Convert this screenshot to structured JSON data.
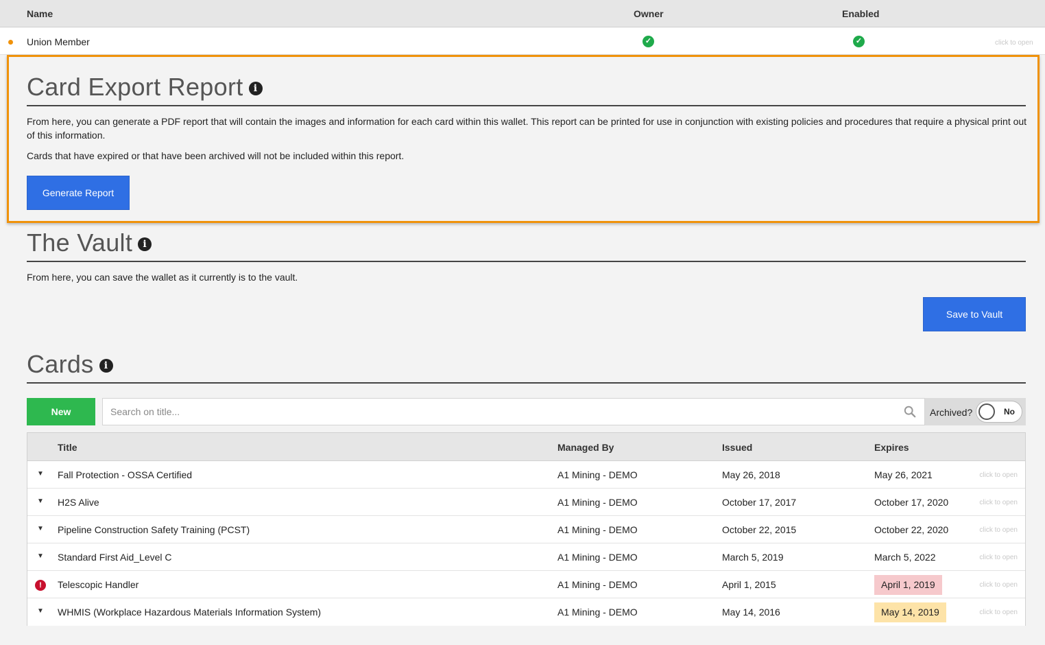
{
  "roles": {
    "headers": {
      "name": "Name",
      "owner": "Owner",
      "enabled": "Enabled"
    },
    "row": {
      "name": "Union Member",
      "hint": "click to open"
    }
  },
  "export": {
    "title": "Card Export Report",
    "para1": "From here, you can generate a PDF report that will contain the images and information for each card within this wallet. This report can be printed for use in conjunction with existing policies and procedures that require a physical print out of this information.",
    "para2": "Cards that have expired or that have been archived will not be included within this report.",
    "button": "Generate Report"
  },
  "vault": {
    "title": "The Vault",
    "para": "From here, you can save the wallet as it currently is to the vault.",
    "button": "Save to Vault"
  },
  "cards": {
    "title": "Cards",
    "new_button": "New",
    "search_placeholder": "Search on title...",
    "archived_label": "Archived?",
    "archived_value": "No",
    "headers": {
      "title": "Title",
      "managed_by": "Managed By",
      "issued": "Issued",
      "expires": "Expires"
    },
    "hint": "click to open",
    "rows": [
      {
        "title": "Fall Protection - OSSA Certified",
        "managed_by": "A1 Mining - DEMO",
        "issued": "May 26, 2018",
        "expires": "May 26, 2021",
        "status": "ok"
      },
      {
        "title": "H2S Alive",
        "managed_by": "A1 Mining - DEMO",
        "issued": "October 17, 2017",
        "expires": "October 17, 2020",
        "status": "ok"
      },
      {
        "title": "Pipeline Construction Safety Training (PCST)",
        "managed_by": "A1 Mining - DEMO",
        "issued": "October 22, 2015",
        "expires": "October 22, 2020",
        "status": "ok"
      },
      {
        "title": "Standard First Aid_Level C",
        "managed_by": "A1 Mining - DEMO",
        "issued": "March 5, 2019",
        "expires": "March 5, 2022",
        "status": "ok"
      },
      {
        "title": "Telescopic Handler",
        "managed_by": "A1 Mining - DEMO",
        "issued": "April 1, 2015",
        "expires": "April 1, 2019",
        "status": "expired"
      },
      {
        "title": "WHMIS (Workplace Hazardous Materials Information System)",
        "managed_by": "A1 Mining - DEMO",
        "issued": "May 14, 2016",
        "expires": "May 14, 2019",
        "status": "expiring"
      }
    ]
  },
  "colors": {
    "accent_blue": "#2f6fe4",
    "new_green": "#2eb84f",
    "highlight_orange": "#f0920a",
    "expired_bg": "#f6c9cc",
    "expiring_bg": "#fde3a8"
  }
}
